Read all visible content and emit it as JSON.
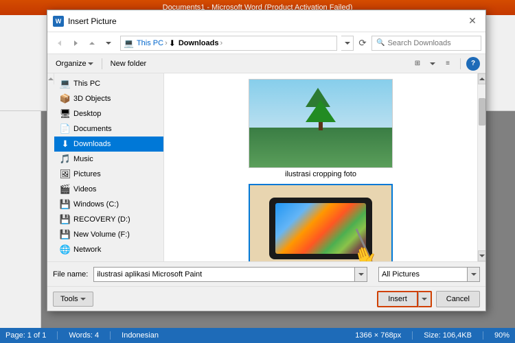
{
  "window": {
    "title": "Documents1 - Microsoft Word (Product Activation Failed)",
    "dialog_title": "Insert Picture"
  },
  "dialog": {
    "title": "Insert Picture",
    "close_label": "✕"
  },
  "nav": {
    "back_label": "←",
    "forward_label": "→",
    "up_label": "↑",
    "breadcrumbs": [
      "This PC",
      "Downloads"
    ],
    "refresh_label": "⟳",
    "search_placeholder": "Search Downloads"
  },
  "toolbar": {
    "organize_label": "Organize",
    "new_folder_label": "New folder",
    "help_label": "?"
  },
  "sidebar": {
    "items": [
      {
        "id": "this-pc",
        "label": "This PC",
        "icon": "💻"
      },
      {
        "id": "3d-objects",
        "label": "3D Objects",
        "icon": "📦"
      },
      {
        "id": "desktop",
        "label": "Desktop",
        "icon": "🖥"
      },
      {
        "id": "documents",
        "label": "Documents",
        "icon": "📄"
      },
      {
        "id": "downloads",
        "label": "Downloads",
        "icon": "⬇",
        "active": true
      },
      {
        "id": "music",
        "label": "Music",
        "icon": "🎵"
      },
      {
        "id": "pictures",
        "label": "Pictures",
        "icon": "🖼"
      },
      {
        "id": "videos",
        "label": "Videos",
        "icon": "🎬"
      },
      {
        "id": "windows-c",
        "label": "Windows (C:)",
        "icon": "💾"
      },
      {
        "id": "recovery-d",
        "label": "RECOVERY (D:)",
        "icon": "💾"
      },
      {
        "id": "new-volume-f",
        "label": "New Volume (F:)",
        "icon": "💾"
      },
      {
        "id": "network",
        "label": "Network",
        "icon": "🌐"
      }
    ]
  },
  "files": [
    {
      "id": "file1",
      "name": "ilustrasi cropping foto",
      "selected": false
    },
    {
      "id": "file2",
      "name": "ilustrasi aplikasi Microsoft Paint",
      "selected": true
    }
  ],
  "bottom": {
    "filename_label": "File name:",
    "filename_value": "ilustrasi aplikasi Microsoft Paint",
    "filetype_value": "All Pictures"
  },
  "actions": {
    "tools_label": "Tools",
    "insert_label": "Insert",
    "cancel_label": "Cancel"
  },
  "statusbar": {
    "page": "Page: 1 of 1",
    "words": "Words: 4",
    "language": "Indonesian",
    "zoom": "90%",
    "resolution": "1366 × 768px",
    "size": "Size: 106,4KB"
  }
}
